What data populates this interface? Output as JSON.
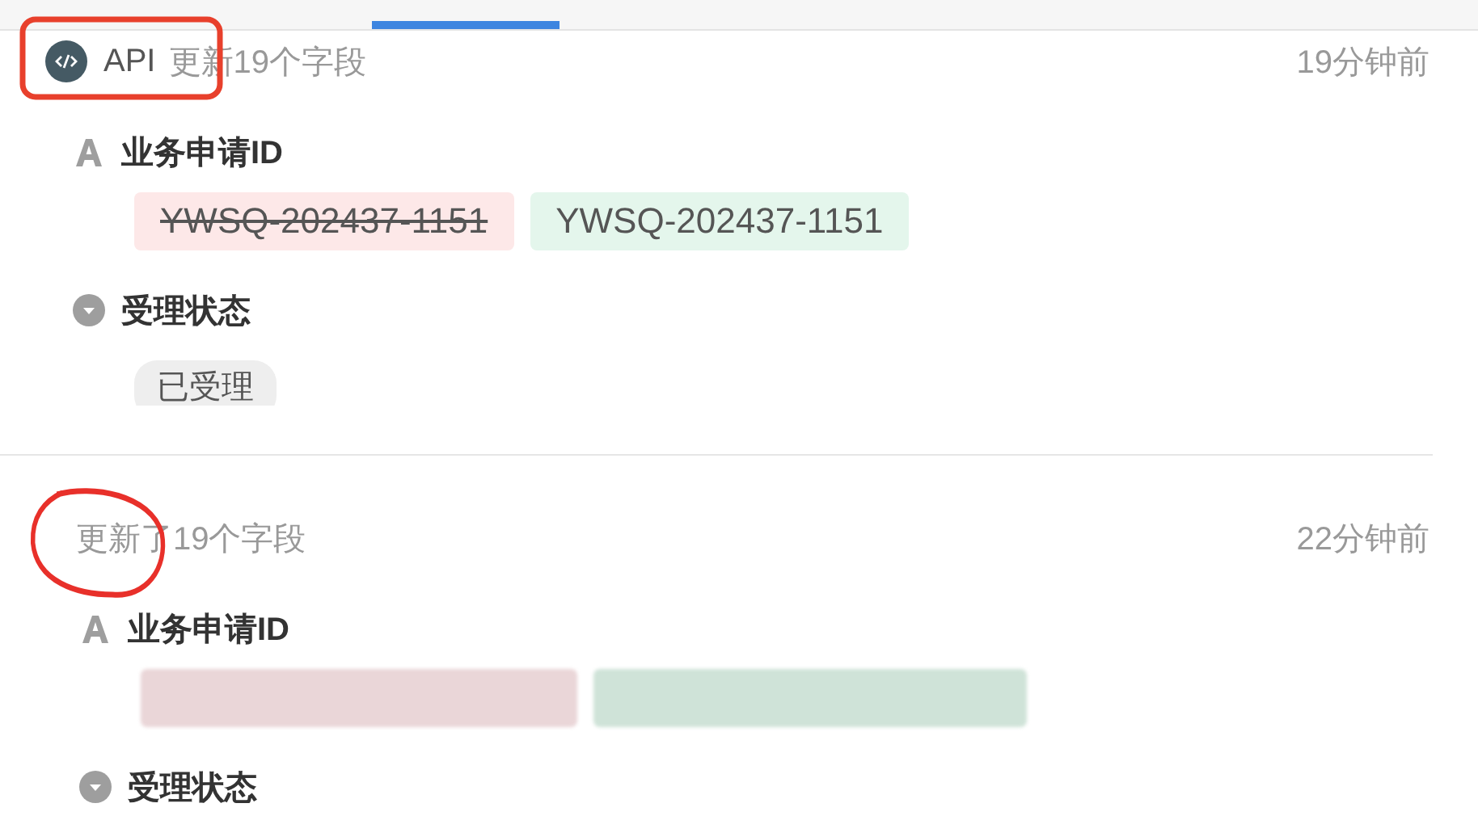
{
  "tabs_indicator": {
    "selected": true
  },
  "entries": [
    {
      "source": "API",
      "summary": "更新19个字段",
      "time": "19分钟前",
      "fields": [
        {
          "kind": "text",
          "label": "业务申请ID",
          "old_value": "YWSQ-202437-1151",
          "new_value": "YWSQ-202437-1151"
        },
        {
          "kind": "select",
          "label": "受理状态",
          "value": "已受理"
        }
      ]
    },
    {
      "summary": "更新了19个字段",
      "time": "22分钟前",
      "fields": [
        {
          "kind": "redacted_text",
          "label": "业务申请ID"
        },
        {
          "kind": "select",
          "label": "受理状态"
        }
      ]
    }
  ]
}
